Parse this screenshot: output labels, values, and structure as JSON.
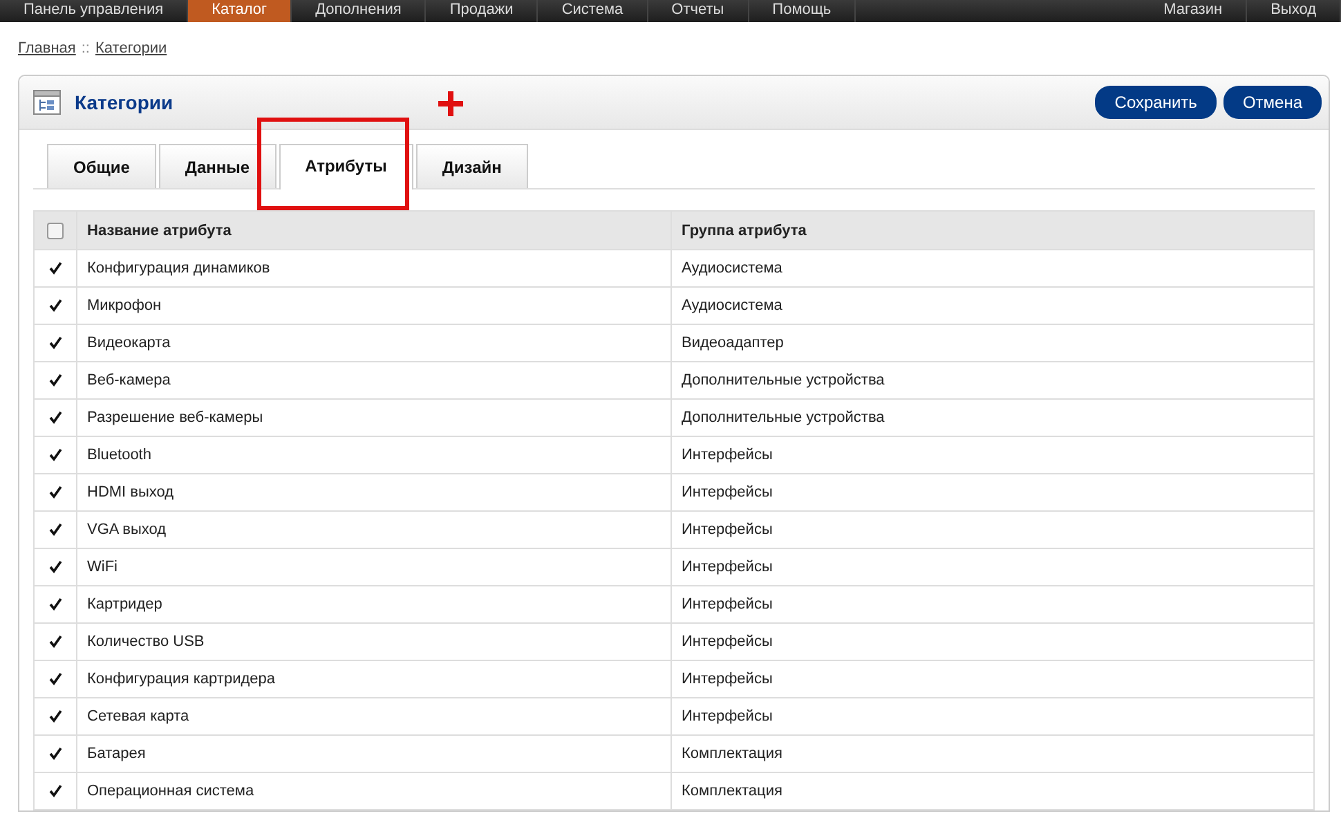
{
  "menu": {
    "items": [
      {
        "label": "Панель управления",
        "selected": false
      },
      {
        "label": "Каталог",
        "selected": true
      },
      {
        "label": "Дополнения",
        "selected": false
      },
      {
        "label": "Продажи",
        "selected": false
      },
      {
        "label": "Система",
        "selected": false
      },
      {
        "label": "Отчеты",
        "selected": false
      },
      {
        "label": "Помощь",
        "selected": false
      }
    ],
    "right_items": [
      "Магазин",
      "Выход"
    ]
  },
  "breadcrumb": {
    "items": [
      "Главная",
      "Категории"
    ],
    "separator": "::"
  },
  "panel": {
    "title": "Категории",
    "buttons": [
      "Сохранить",
      "Отмена"
    ]
  },
  "tabs": [
    {
      "label": "Общие",
      "selected": false
    },
    {
      "label": "Данные",
      "selected": false
    },
    {
      "label": "Атрибуты",
      "selected": true
    },
    {
      "label": "Дизайн",
      "selected": false
    }
  ],
  "table": {
    "header_checked": false,
    "columns": [
      "Название атрибута",
      "Группа атрибута"
    ],
    "rows": [
      {
        "checked": true,
        "name": "Конфигурация динамиков",
        "group": "Аудиосистема"
      },
      {
        "checked": true,
        "name": "Микрофон",
        "group": "Аудиосистема"
      },
      {
        "checked": true,
        "name": "Видеокарта",
        "group": "Видеоадаптер"
      },
      {
        "checked": true,
        "name": "Веб-камера",
        "group": "Дополнительные устройства"
      },
      {
        "checked": true,
        "name": "Разрешение веб-камеры",
        "group": "Дополнительные устройства"
      },
      {
        "checked": true,
        "name": "Bluetooth",
        "group": "Интерфейсы"
      },
      {
        "checked": true,
        "name": "HDMI выход",
        "group": "Интерфейсы"
      },
      {
        "checked": true,
        "name": "VGA выход",
        "group": "Интерфейсы"
      },
      {
        "checked": true,
        "name": "WiFi",
        "group": "Интерфейсы"
      },
      {
        "checked": true,
        "name": "Картридер",
        "group": "Интерфейсы"
      },
      {
        "checked": true,
        "name": "Количество USB",
        "group": "Интерфейсы"
      },
      {
        "checked": true,
        "name": "Конфигурация картридера",
        "group": "Интерфейсы"
      },
      {
        "checked": true,
        "name": "Сетевая карта",
        "group": "Интерфейсы"
      },
      {
        "checked": true,
        "name": "Батарея",
        "group": "Комплектация"
      },
      {
        "checked": true,
        "name": "Операционная система",
        "group": "Комплектация"
      }
    ]
  }
}
